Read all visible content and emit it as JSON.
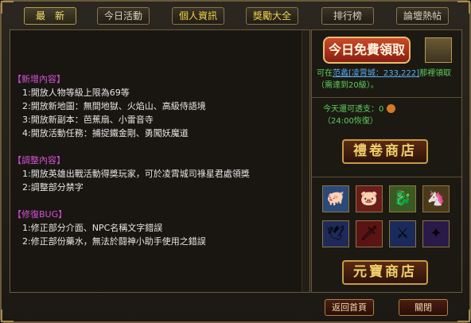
{
  "tabs": [
    {
      "label": "最　新"
    },
    {
      "label": "今日活動"
    },
    {
      "label": "個人資訊"
    },
    {
      "label": "獎勵大全"
    },
    {
      "label": "排行榜"
    },
    {
      "label": "論壇熱帖"
    }
  ],
  "content": {
    "new_header": "【新增內容】",
    "new_items": [
      "1:開放人物等級上限為69等",
      "2:開放新地圖：無間地獄、火焰山、高級侍語境",
      "3:開放新副本：芭蕉扇、小雷音寺",
      "4:開放活動任務：捕捉鐵金剛、勇闖妖魔道"
    ],
    "adjust_header": "【調整內容】",
    "adjust_items": [
      "1:開放英雄出戰活動得獎玩家，可於凌霄城司祿星君處領獎",
      "2:調整部分禁字"
    ],
    "bug_header": "【修復BUG】",
    "bug_items": [
      "1:修正部分介面、NPC名稱文字錯誤",
      "2:修正部份藥水，無法於鬪神小助手使用之錯誤"
    ]
  },
  "side": {
    "free_button": "今日免費領取",
    "note_prefix": "可在",
    "note_link": "范蠡[凌霄城：233,222]",
    "note_suffix": "那裡領取（需達到20級）。",
    "today_remaining": "今天還可透支：0",
    "recover": "（24:00恢復）",
    "gift_shop": "禮卷商店",
    "ingot_shop": "元寶商店",
    "items": [
      {
        "name": "pig-mount-icon",
        "glyph": "🐖"
      },
      {
        "name": "pig-red-icon",
        "glyph": "🐷"
      },
      {
        "name": "dragon-mount-icon",
        "glyph": "🐉"
      },
      {
        "name": "golden-mount-icon",
        "glyph": "🦄"
      },
      {
        "name": "white-bird-icon",
        "glyph": "🕊"
      },
      {
        "name": "red-sword-icon",
        "glyph": "🗡"
      },
      {
        "name": "blue-sword-icon",
        "glyph": "⚔"
      },
      {
        "name": "staff-icon",
        "glyph": "✦"
      }
    ]
  },
  "bottom": {
    "home": "返回首頁",
    "close": "關閉"
  }
}
